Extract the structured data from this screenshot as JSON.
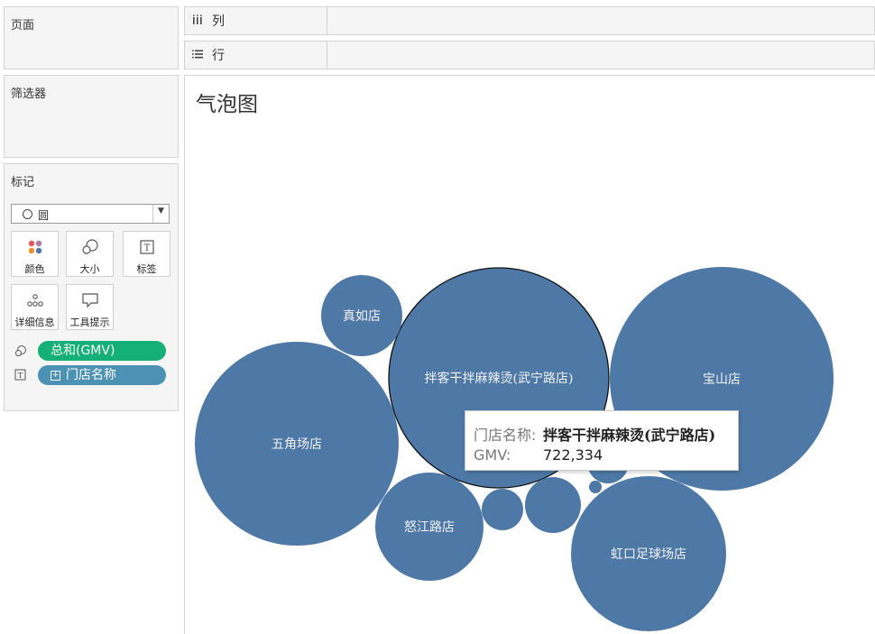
{
  "shelves": {
    "pages_label": "页面",
    "filters_label": "筛选器",
    "marks_label": "标记",
    "columns_label": "列",
    "rows_label": "行"
  },
  "marks": {
    "mark_type": "圆",
    "buttons": [
      {
        "label": "颜色",
        "icon": "color-dots-icon"
      },
      {
        "label": "大小",
        "icon": "size-circles-icon"
      },
      {
        "label": "标签",
        "icon": "text-label-icon"
      },
      {
        "label": "详细信息",
        "icon": "detail-dots-icon"
      },
      {
        "label": "工具提示",
        "icon": "tooltip-bubble-icon"
      }
    ],
    "pills": [
      {
        "label": "总和(GMV)",
        "icon": "size-icon",
        "color": "#15b079"
      },
      {
        "label": "门店名称",
        "icon": "text-icon",
        "color": "#4b92b5"
      }
    ]
  },
  "view": {
    "title": "气泡图"
  },
  "chart_data": {
    "type": "bubble",
    "measure": "GMV",
    "dimension": "门店名称",
    "bubble_color": "#4e79a7",
    "stores": [
      {
        "name": "拌客干拌麻辣烫(武宁路店)",
        "gmv": 722334,
        "selected": true
      },
      {
        "name": "宝山店",
        "gmv": null
      },
      {
        "name": "五角场店",
        "gmv": null
      },
      {
        "name": "虹口足球场店",
        "gmv": null
      },
      {
        "name": "怒江路店",
        "gmv": null
      },
      {
        "name": "真如店",
        "gmv": null
      },
      {
        "name": "",
        "gmv": null
      },
      {
        "name": "",
        "gmv": null
      },
      {
        "name": "",
        "gmv": null
      },
      {
        "name": "",
        "gmv": null
      }
    ]
  },
  "tooltip": {
    "store_key": "门店名称:",
    "store_value": "拌客干拌麻辣烫(武宁路店)",
    "gmv_key": "GMV:",
    "gmv_value": "722,334"
  }
}
